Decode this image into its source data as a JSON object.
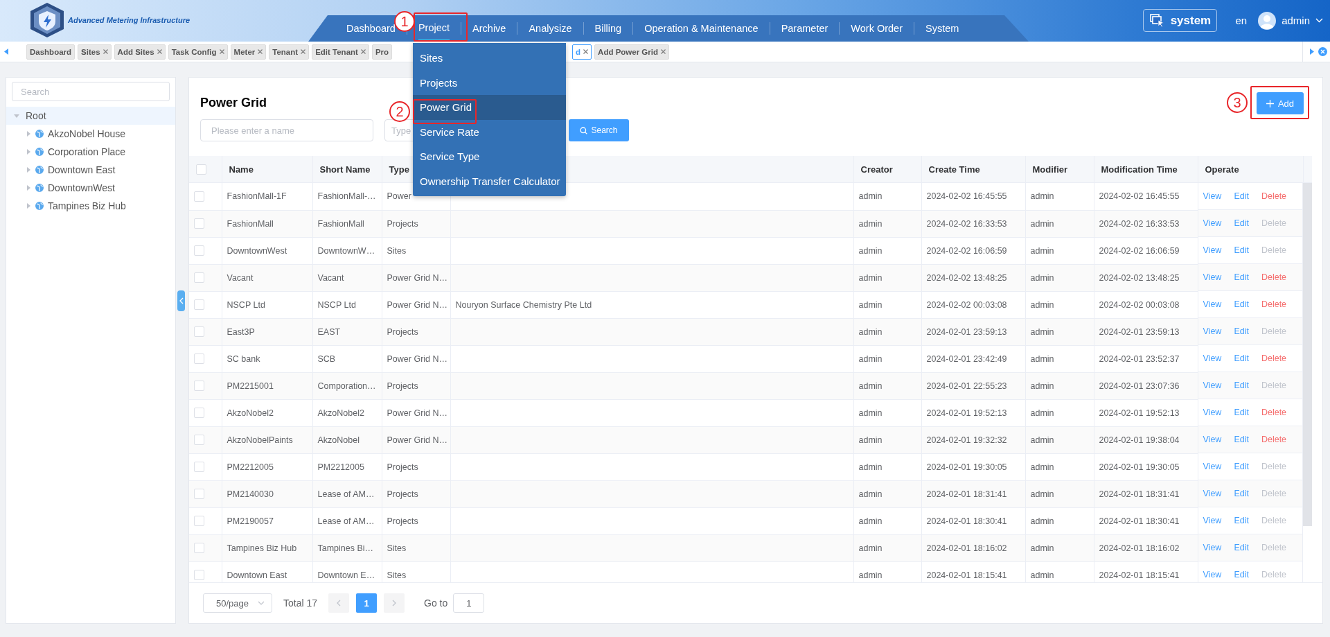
{
  "app": {
    "title": "Advanced Metering Infrastructure"
  },
  "nav": [
    {
      "label": "Dashboard",
      "selected": false
    },
    {
      "label": "Project",
      "selected": true
    },
    {
      "label": "Archive",
      "selected": false
    },
    {
      "label": "Analysize",
      "selected": false
    },
    {
      "label": "Billing",
      "selected": false
    },
    {
      "label": "Operation & Maintenance",
      "selected": false
    },
    {
      "label": "Parameter",
      "selected": false
    },
    {
      "label": "Work Order",
      "selected": false
    },
    {
      "label": "System",
      "selected": false
    }
  ],
  "header_right": {
    "system_button": "system",
    "language": "en",
    "user": "admin"
  },
  "open_tabs": [
    {
      "label": "Dashboard",
      "closable": false,
      "selected": false
    },
    {
      "label": "Sites",
      "closable": true,
      "selected": false
    },
    {
      "label": "Add Sites",
      "closable": true,
      "selected": false
    },
    {
      "label": "Task Config",
      "closable": true,
      "selected": false
    },
    {
      "label": "Meter",
      "closable": true,
      "selected": false
    },
    {
      "label": "Tenant",
      "closable": true,
      "selected": false
    },
    {
      "label": "Edit Tenant",
      "closable": true,
      "selected": false
    },
    {
      "label": "Pro",
      "closable": false,
      "selected": false
    },
    {
      "label": "d",
      "closable": true,
      "selected": true
    },
    {
      "label": "Add Power Grid",
      "closable": true,
      "selected": false
    }
  ],
  "dropdown": {
    "items": [
      {
        "label": "Sites",
        "selected": false
      },
      {
        "label": "Projects",
        "selected": false
      },
      {
        "label": "Power Grid",
        "selected": true
      },
      {
        "label": "Service Rate",
        "selected": false
      },
      {
        "label": "Service Type",
        "selected": false
      },
      {
        "label": "Ownership Transfer Calculator",
        "selected": false
      }
    ]
  },
  "annotations": [
    {
      "label": "1"
    },
    {
      "label": "2"
    },
    {
      "label": "3"
    }
  ],
  "sidebar": {
    "search": {
      "placeholder": "Search"
    },
    "tree": [
      {
        "label": "Root",
        "expanded": true,
        "selected": true,
        "children": [
          {
            "label": "AkzoNobel House",
            "expanded": false,
            "selected": false
          },
          {
            "label": "Corporation Place",
            "expanded": false,
            "selected": false
          },
          {
            "label": "Downtown East",
            "expanded": false,
            "selected": false
          },
          {
            "label": "DowntownWest",
            "expanded": false,
            "selected": false
          },
          {
            "label": "Tampines Biz Hub",
            "expanded": false,
            "selected": false
          }
        ]
      }
    ]
  },
  "page": {
    "title": "Power Grid",
    "add_button": "Add",
    "filters": {
      "name": {
        "placeholder": "Please enter a name"
      },
      "type": {
        "placeholder": "Type"
      }
    },
    "search_button": "Search"
  },
  "table": {
    "header_checkbox": {
      "checked": false
    },
    "columns": [
      "Name",
      "Short Name",
      "Type",
      "Creator",
      "Create Time",
      "Modifier",
      "Modification Time",
      "Operate"
    ],
    "rows": [
      {
        "checked": false,
        "name": "FashionMall-1F",
        "short_name": "FashionMall-…",
        "type": "Power",
        "creator": "admin",
        "create_time": "2024-02-02 16:45:55",
        "modifier": "admin",
        "modification_time": "2024-02-02 16:45:55",
        "view": "View",
        "edit": "Edit",
        "delete": {
          "label": "Delete",
          "disabled": false
        }
      },
      {
        "checked": false,
        "name": "FashionMall",
        "short_name": "FashionMall",
        "type": "Projects",
        "creator": "admin",
        "create_time": "2024-02-02 16:33:53",
        "modifier": "admin",
        "modification_time": "2024-02-02 16:33:53",
        "view": "View",
        "edit": "Edit",
        "delete": {
          "label": "Delete",
          "disabled": true
        }
      },
      {
        "checked": false,
        "name": "DowntownWest",
        "short_name": "DowntownW…",
        "type": "Sites",
        "creator": "admin",
        "create_time": "2024-02-02 16:06:59",
        "modifier": "admin",
        "modification_time": "2024-02-02 16:06:59",
        "view": "View",
        "edit": "Edit",
        "delete": {
          "label": "Delete",
          "disabled": true
        }
      },
      {
        "checked": false,
        "name": "Vacant",
        "short_name": "Vacant",
        "type": "Power Grid N…",
        "creator": "admin",
        "create_time": "2024-02-02 13:48:25",
        "modifier": "admin",
        "modification_time": "2024-02-02 13:48:25",
        "view": "View",
        "edit": "Edit",
        "delete": {
          "label": "Delete",
          "disabled": false
        }
      },
      {
        "checked": false,
        "name": "NSCP Ltd",
        "short_name": "NSCP Ltd",
        "type": "Power Grid N…",
        "column_4": "Nouryon Surface Chemistry Pte Ltd",
        "creator": "admin",
        "create_time": "2024-02-02 00:03:08",
        "modifier": "admin",
        "modification_time": "2024-02-02 00:03:08",
        "view": "View",
        "edit": "Edit",
        "delete": {
          "label": "Delete",
          "disabled": false
        }
      },
      {
        "checked": false,
        "name": "East3P",
        "short_name": "EAST",
        "type": "Projects",
        "creator": "admin",
        "create_time": "2024-02-01 23:59:13",
        "modifier": "admin",
        "modification_time": "2024-02-01 23:59:13",
        "view": "View",
        "edit": "Edit",
        "delete": {
          "label": "Delete",
          "disabled": true
        }
      },
      {
        "checked": false,
        "name": "SC bank",
        "short_name": "SCB",
        "type": "Power Grid N…",
        "creator": "admin",
        "create_time": "2024-02-01 23:42:49",
        "modifier": "admin",
        "modification_time": "2024-02-01 23:52:37",
        "view": "View",
        "edit": "Edit",
        "delete": {
          "label": "Delete",
          "disabled": false
        }
      },
      {
        "checked": false,
        "name": "PM2215001",
        "short_name": "Comporation…",
        "type": "Projects",
        "creator": "admin",
        "create_time": "2024-02-01 22:55:23",
        "modifier": "admin",
        "modification_time": "2024-02-01 23:07:36",
        "view": "View",
        "edit": "Edit",
        "delete": {
          "label": "Delete",
          "disabled": true
        }
      },
      {
        "checked": false,
        "name": "AkzoNobel2",
        "short_name": "AkzoNobel2",
        "type": "Power Grid N…",
        "creator": "admin",
        "create_time": "2024-02-01 19:52:13",
        "modifier": "admin",
        "modification_time": "2024-02-01 19:52:13",
        "view": "View",
        "edit": "Edit",
        "delete": {
          "label": "Delete",
          "disabled": false
        }
      },
      {
        "checked": false,
        "name": "AkzoNobelPaints",
        "short_name": "AkzoNobel",
        "type": "Power Grid N…",
        "creator": "admin",
        "create_time": "2024-02-01 19:32:32",
        "modifier": "admin",
        "modification_time": "2024-02-01 19:38:04",
        "view": "View",
        "edit": "Edit",
        "delete": {
          "label": "Delete",
          "disabled": false
        }
      },
      {
        "checked": false,
        "name": "PM2212005",
        "short_name": "PM2212005",
        "type": "Projects",
        "creator": "admin",
        "create_time": "2024-02-01 19:30:05",
        "modifier": "admin",
        "modification_time": "2024-02-01 19:30:05",
        "view": "View",
        "edit": "Edit",
        "delete": {
          "label": "Delete",
          "disabled": true
        }
      },
      {
        "checked": false,
        "name": "PM2140030",
        "short_name": "Lease of AM…",
        "type": "Projects",
        "creator": "admin",
        "create_time": "2024-02-01 18:31:41",
        "modifier": "admin",
        "modification_time": "2024-02-01 18:31:41",
        "view": "View",
        "edit": "Edit",
        "delete": {
          "label": "Delete",
          "disabled": true
        }
      },
      {
        "checked": false,
        "name": "PM2190057",
        "short_name": "Lease of AM…",
        "type": "Projects",
        "creator": "admin",
        "create_time": "2024-02-01 18:30:41",
        "modifier": "admin",
        "modification_time": "2024-02-01 18:30:41",
        "view": "View",
        "edit": "Edit",
        "delete": {
          "label": "Delete",
          "disabled": true
        }
      },
      {
        "checked": false,
        "name": "Tampines Biz Hub",
        "short_name": "Tampines Bi…",
        "type": "Sites",
        "creator": "admin",
        "create_time": "2024-02-01 18:16:02",
        "modifier": "admin",
        "modification_time": "2024-02-01 18:16:02",
        "view": "View",
        "edit": "Edit",
        "delete": {
          "label": "Delete",
          "disabled": true
        }
      },
      {
        "checked": false,
        "name": "Downtown East",
        "short_name": "Downtown E…",
        "type": "Sites",
        "creator": "admin",
        "create_time": "2024-02-01 18:15:41",
        "modifier": "admin",
        "modification_time": "2024-02-01 18:15:41",
        "view": "View",
        "edit": "Edit",
        "delete": {
          "label": "Delete",
          "disabled": true
        }
      }
    ]
  },
  "pagination": {
    "page_size": "50/page",
    "total": "Total 17",
    "pages": [
      {
        "label": "1",
        "selected": true
      }
    ],
    "goto_label": "Go to",
    "goto_value": "1"
  }
}
